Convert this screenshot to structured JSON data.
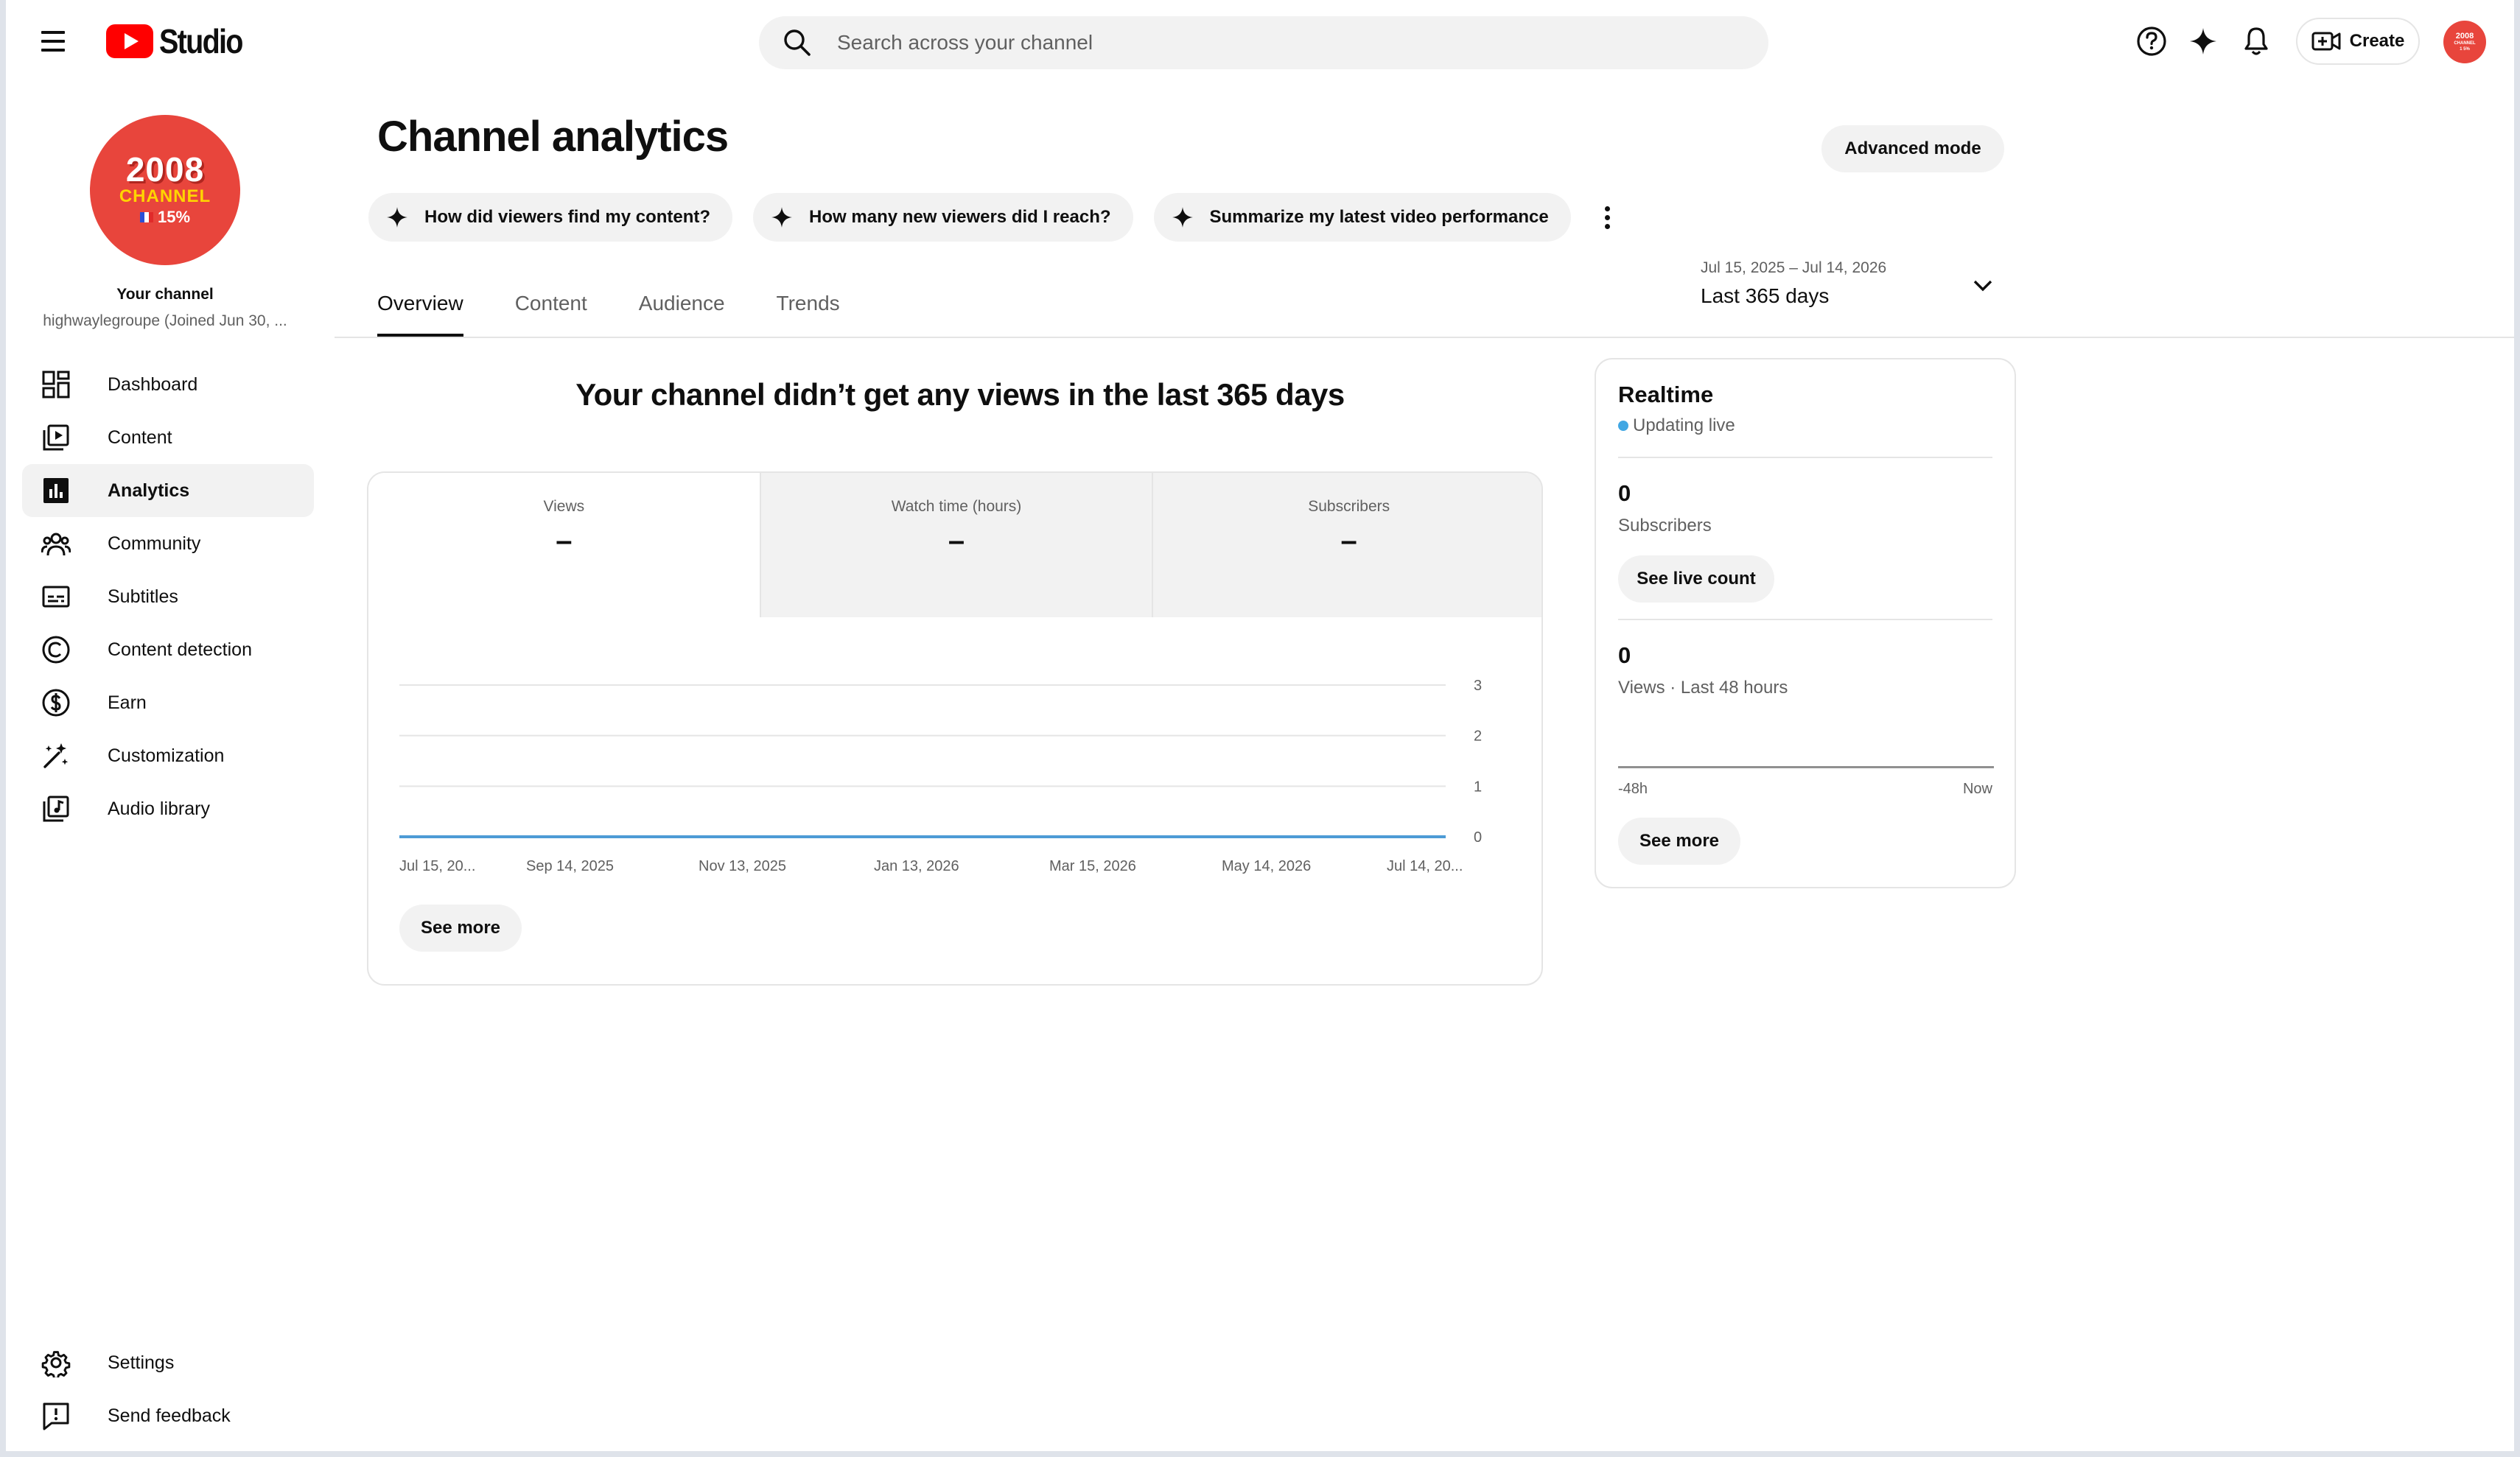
{
  "header": {
    "logo_text": "Studio",
    "search_placeholder": "Search across your channel",
    "create_label": "Create",
    "avatar_text": [
      "2008",
      "CHANNEL",
      "1 5%"
    ]
  },
  "sidebar": {
    "avatar": {
      "year": "2008",
      "word": "CHANNEL",
      "percent": "15%"
    },
    "your_channel": "Your channel",
    "handle": "highwaylegroupe (Joined Jun 30, ...",
    "items": [
      {
        "label": "Dashboard",
        "icon": "dashboard-icon"
      },
      {
        "label": "Content",
        "icon": "content-icon"
      },
      {
        "label": "Analytics",
        "icon": "analytics-icon",
        "active": true
      },
      {
        "label": "Community",
        "icon": "community-icon"
      },
      {
        "label": "Subtitles",
        "icon": "subtitles-icon"
      },
      {
        "label": "Content detection",
        "icon": "copyright-icon"
      },
      {
        "label": "Earn",
        "icon": "dollar-icon"
      },
      {
        "label": "Customization",
        "icon": "magic-wand-icon"
      },
      {
        "label": "Audio library",
        "icon": "audio-library-icon"
      }
    ],
    "bottom_items": [
      {
        "label": "Settings",
        "icon": "gear-icon"
      },
      {
        "label": "Send feedback",
        "icon": "feedback-icon"
      }
    ]
  },
  "main": {
    "title": "Channel analytics",
    "advanced_mode_label": "Advanced mode",
    "ask_chips": [
      "How did viewers find my content?",
      "How many new viewers did I reach?",
      "Summarize my latest video performance"
    ],
    "tabs": [
      {
        "label": "Overview",
        "active": true
      },
      {
        "label": "Content"
      },
      {
        "label": "Audience"
      },
      {
        "label": "Trends"
      }
    ],
    "date_range": {
      "dates": "Jul 15, 2025 – Jul 14, 2026",
      "period": "Last 365 days"
    },
    "no_views_message": "Your channel didn’t get any views in the last 365 days",
    "metrics": [
      {
        "label": "Views",
        "value": "–"
      },
      {
        "label": "Watch time (hours)",
        "value": "–"
      },
      {
        "label": "Subscribers",
        "value": "–"
      }
    ],
    "see_more_label": "See more"
  },
  "chart_data": {
    "type": "line",
    "x": [
      "Jul 15, 20...",
      "Sep 14, 2025",
      "Nov 13, 2025",
      "Jan 13, 2026",
      "Mar 15, 2026",
      "May 14, 2026",
      "Jul 14, 20..."
    ],
    "series": [
      {
        "values": [
          0,
          0,
          0,
          0,
          0,
          0,
          0
        ]
      }
    ],
    "y_ticks": [
      0,
      1,
      2,
      3
    ],
    "ylim": [
      0,
      3
    ],
    "grid": true,
    "color": "#4d9bd6"
  },
  "realtime": {
    "title": "Realtime",
    "status": "Updating live",
    "subscribers_value": "0",
    "subscribers_label": "Subscribers",
    "see_live_count_label": "See live count",
    "views_value": "0",
    "views_label": "Views · Last 48 hours",
    "axis_start": "-48h",
    "axis_end": "Now",
    "see_more_label": "See more"
  },
  "colors": {
    "brand_red": "#ff0000",
    "accent_blue": "#41a7e3",
    "chip_bg": "#f2f2f2"
  }
}
